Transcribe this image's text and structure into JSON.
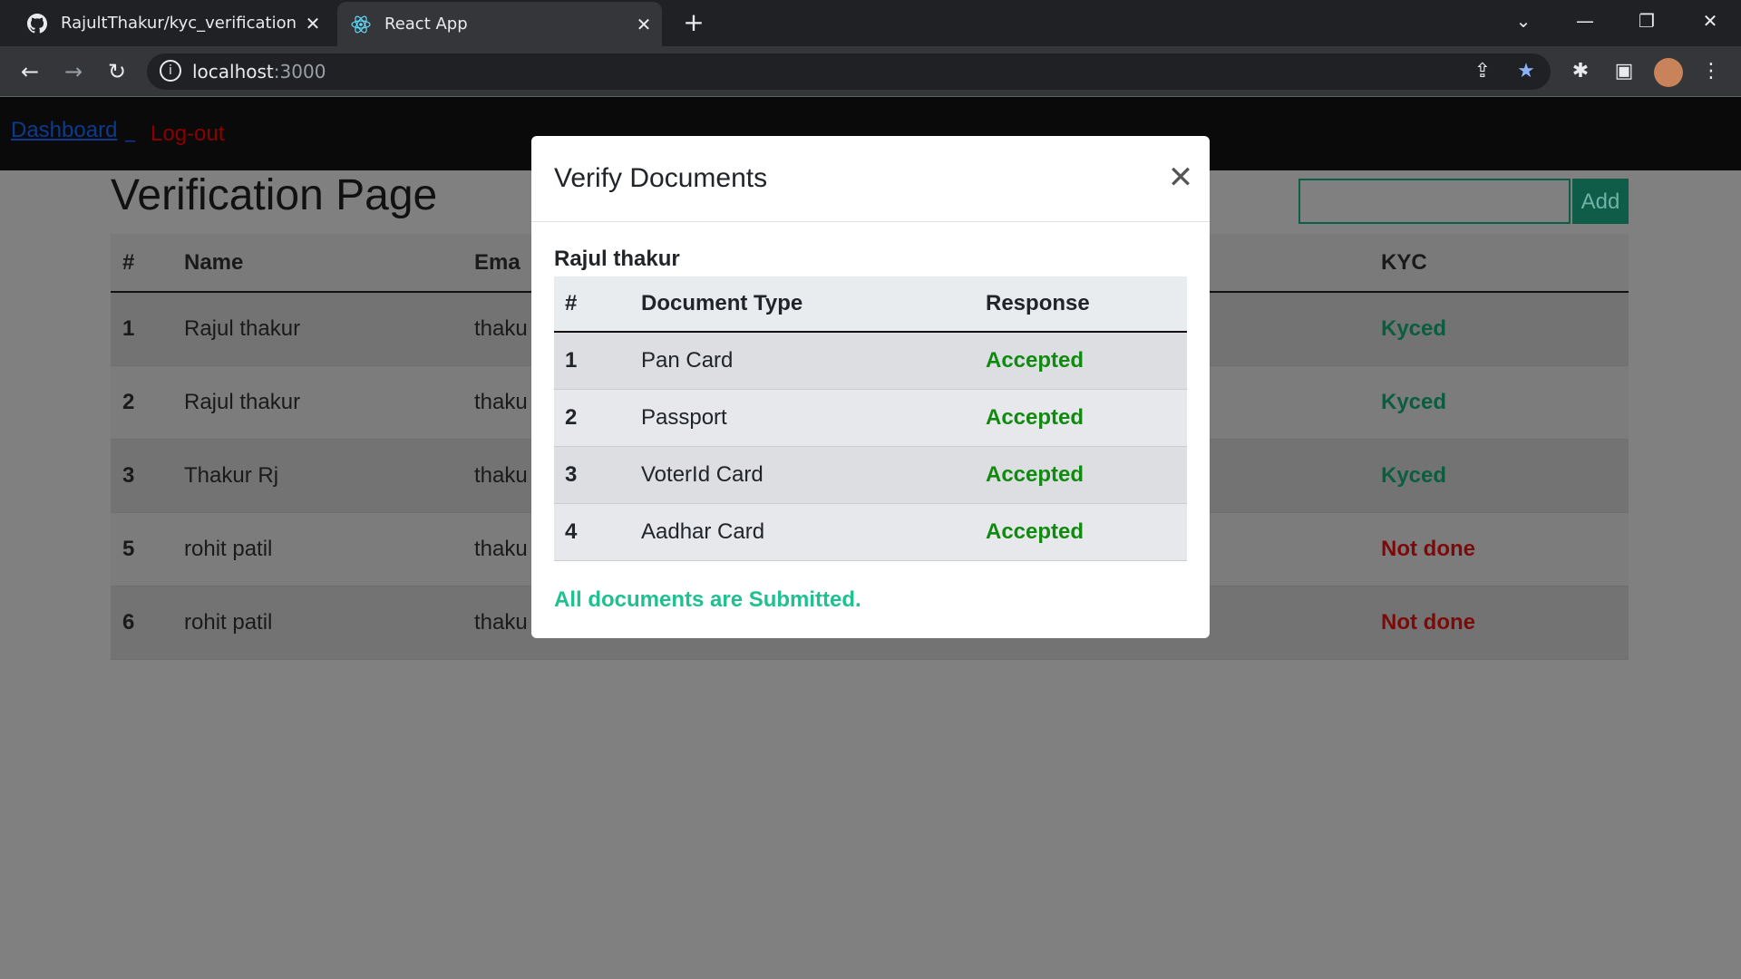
{
  "browser": {
    "tabs": [
      {
        "title": "RajultThakur/kyc_verification",
        "icon": "github-icon"
      },
      {
        "title": "React App",
        "icon": "react-icon"
      }
    ],
    "url_host": "localhost",
    "url_port": ":3000"
  },
  "nav": {
    "dashboard": "Dashboard",
    "separator": "_",
    "logout": "Log-out"
  },
  "page": {
    "title": "Verification Page",
    "add_button": "Add",
    "table": {
      "headers": [
        "#",
        "Name",
        "Ema",
        "KYC"
      ],
      "rows": [
        {
          "num": "1",
          "name": "Rajul thakur",
          "email": "thaku",
          "kyc": "Kyced"
        },
        {
          "num": "2",
          "name": "Rajul thakur",
          "email": "thaku",
          "kyc": "Kyced"
        },
        {
          "num": "3",
          "name": "Thakur Rj",
          "email": "thaku",
          "kyc": "Kyced"
        },
        {
          "num": "5",
          "name": "rohit patil",
          "email": "thaku",
          "kyc": "Not done"
        },
        {
          "num": "6",
          "name": "rohit patil",
          "email": "thaku",
          "kyc": "Not done"
        }
      ]
    }
  },
  "modal": {
    "title": "Verify Documents",
    "user": "Rajul thakur",
    "headers": [
      "#",
      "Document Type",
      "Response"
    ],
    "rows": [
      {
        "num": "1",
        "type": "Pan Card",
        "response": "Accepted"
      },
      {
        "num": "2",
        "type": "Passport",
        "response": "Accepted"
      },
      {
        "num": "3",
        "type": "VoterId Card",
        "response": "Accepted"
      },
      {
        "num": "4",
        "type": "Aadhar Card",
        "response": "Accepted"
      }
    ],
    "status": "All documents are Submitted."
  },
  "colors": {
    "accepted": "#128a12",
    "kyced": "#0a5e3f",
    "not_done": "#7c0a0a",
    "status": "#20c090"
  }
}
